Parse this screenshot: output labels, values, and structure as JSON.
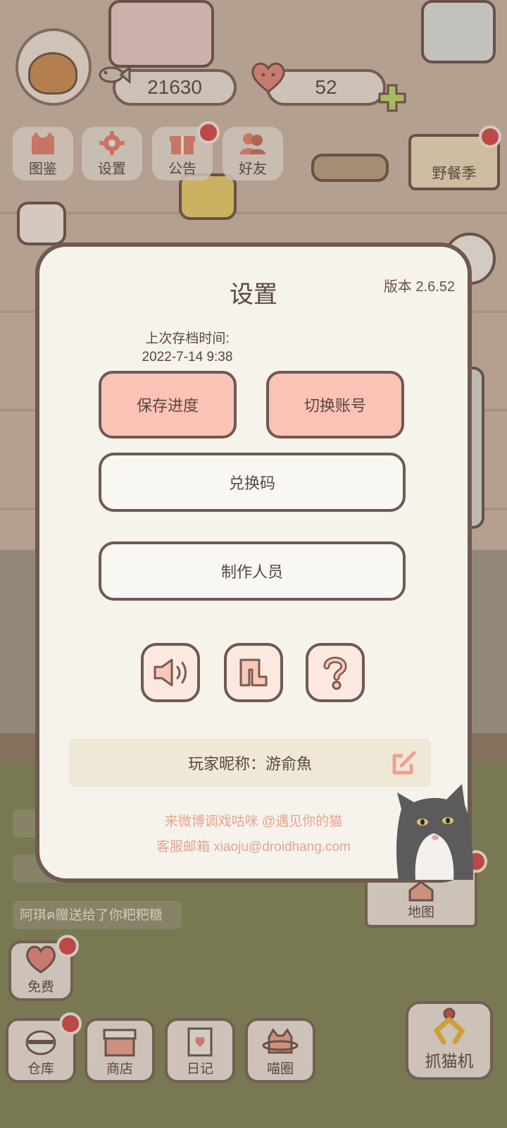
{
  "hud": {
    "fish_count": "21630",
    "heart_count": "52",
    "buttons": [
      {
        "label": "图鉴",
        "icon": "cat-book-icon"
      },
      {
        "label": "设置",
        "icon": "gear-icon"
      },
      {
        "label": "公告",
        "icon": "gift-icon"
      },
      {
        "label": "好友",
        "icon": "friends-icon"
      }
    ],
    "event_sign": "野餐季"
  },
  "feed": {
    "item_3": "阿琪ฅ赠送给了你粑粑糖"
  },
  "settings": {
    "title": "设置",
    "version": "版本 2.6.52",
    "last_save_label": "上次存档时间:",
    "last_save_time": "2022-7-14 9:38",
    "save_button": "保存进度",
    "switch_account_button": "切换账号",
    "redeem_button": "兑换码",
    "credits_button": "制作人员",
    "icon_buttons": [
      "sound-icon",
      "music-icon",
      "help-icon"
    ],
    "nickname": "玩家昵称：游俞魚",
    "weibo_line": "来微博调戏咕咪 @遇见你的猫",
    "support_line": "客服邮箱 xiaoju@droidhang.com"
  },
  "bottom": {
    "free_label": "免费",
    "warehouse_label": "仓库",
    "shop_label": "商店",
    "diary_label": "日记",
    "circle_label": "喵圈",
    "claw_label": "抓猫机",
    "map_label": "地图"
  },
  "colors": {
    "accent_pink": "#fbc3b6",
    "border_brown": "#6f5a50",
    "modal_bg": "#f6f2ec",
    "badge_red": "#d44a4a",
    "footer_text": "#e4a48f"
  }
}
